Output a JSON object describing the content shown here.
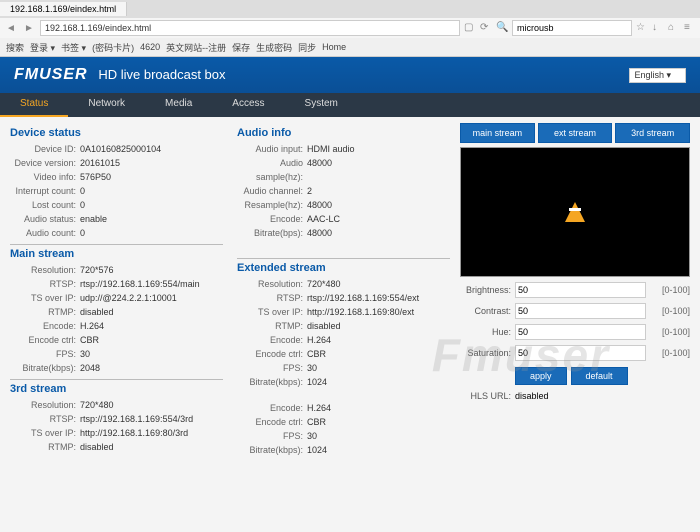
{
  "browser": {
    "url": "192.168.1.169/eindex.html",
    "search": "microusb",
    "bookmarks": [
      "搜索",
      "登录 ▾",
      "书签 ▾",
      "(密码卡片)",
      "4620",
      "英文网站--注册",
      "保存",
      "生成密码",
      "同步",
      "Home"
    ]
  },
  "header": {
    "brand": "FMUSER",
    "subtitle": "HD live broadcast box",
    "lang": "English ▾"
  },
  "nav": [
    "Status",
    "Network",
    "Media",
    "Access",
    "System"
  ],
  "device_status": {
    "title": "Device status",
    "rows": [
      {
        "lbl": "Device ID:",
        "val": "0A10160825000104"
      },
      {
        "lbl": "Device version:",
        "val": "20161015"
      },
      {
        "lbl": "Video info:",
        "val": "576P50"
      },
      {
        "lbl": "Interrupt count:",
        "val": "0"
      },
      {
        "lbl": "Lost count:",
        "val": "0"
      },
      {
        "lbl": "Audio status:",
        "val": "enable"
      },
      {
        "lbl": "Audio count:",
        "val": "0"
      }
    ]
  },
  "audio_info": {
    "title": "Audio info",
    "rows": [
      {
        "lbl": "Audio input:",
        "val": "HDMI audio"
      },
      {
        "lbl": "Audio sample(hz):",
        "val": "48000"
      },
      {
        "lbl": "Audio channel:",
        "val": "2"
      },
      {
        "lbl": "Resample(hz):",
        "val": "48000"
      },
      {
        "lbl": "Encode:",
        "val": "AAC-LC"
      },
      {
        "lbl": "Bitrate(bps):",
        "val": "48000"
      }
    ]
  },
  "main_stream": {
    "title": "Main stream",
    "rows": [
      {
        "lbl": "Resolution:",
        "val": "720*576"
      },
      {
        "lbl": "RTSP:",
        "val": "rtsp://192.168.1.169:554/main"
      },
      {
        "lbl": "TS over IP:",
        "val": "udp://@224.2.2.1:10001"
      },
      {
        "lbl": "RTMP:",
        "val": "disabled"
      },
      {
        "lbl": "Encode:",
        "val": "H.264"
      },
      {
        "lbl": "Encode ctrl:",
        "val": "CBR"
      },
      {
        "lbl": "FPS:",
        "val": "30"
      },
      {
        "lbl": "Bitrate(kbps):",
        "val": "2048"
      }
    ]
  },
  "ext_stream": {
    "title": "Extended stream",
    "rows": [
      {
        "lbl": "Resolution:",
        "val": "720*480"
      },
      {
        "lbl": "RTSP:",
        "val": "rtsp://192.168.1.169:554/ext"
      },
      {
        "lbl": "TS over IP:",
        "val": "http://192.168.1.169:80/ext"
      },
      {
        "lbl": "RTMP:",
        "val": "disabled"
      },
      {
        "lbl": "Encode:",
        "val": "H.264"
      },
      {
        "lbl": "Encode ctrl:",
        "val": "CBR"
      },
      {
        "lbl": "FPS:",
        "val": "30"
      },
      {
        "lbl": "Bitrate(kbps):",
        "val": "1024"
      }
    ]
  },
  "third_stream": {
    "title": "3rd stream",
    "rows": [
      {
        "lbl": "Resolution:",
        "val": "720*480"
      },
      {
        "lbl": "RTSP:",
        "val": "rtsp://192.168.1.169:554/3rd"
      },
      {
        "lbl": "TS over IP:",
        "val": "http://192.168.1.169:80/3rd"
      },
      {
        "lbl": "RTMP:",
        "val": "disabled"
      }
    ]
  },
  "third_stream_right": {
    "rows": [
      {
        "lbl": "Encode:",
        "val": "H.264"
      },
      {
        "lbl": "Encode ctrl:",
        "val": "CBR"
      },
      {
        "lbl": "FPS:",
        "val": "30"
      },
      {
        "lbl": "Bitrate(kbps):",
        "val": "1024"
      }
    ]
  },
  "stream_tabs": [
    "main stream",
    "ext stream",
    "3rd stream"
  ],
  "controls": {
    "brightness": {
      "lbl": "Brightness:",
      "val": "50",
      "rng": "[0-100]"
    },
    "contrast": {
      "lbl": "Contrast:",
      "val": "50",
      "rng": "[0-100]"
    },
    "hue": {
      "lbl": "Hue:",
      "val": "50",
      "rng": "[0-100]"
    },
    "saturation": {
      "lbl": "Saturation:",
      "val": "50",
      "rng": "[0-100]"
    },
    "apply": "apply",
    "default": "default",
    "hls": {
      "lbl": "HLS URL:",
      "val": "disabled"
    }
  },
  "watermark": "Fmuser"
}
